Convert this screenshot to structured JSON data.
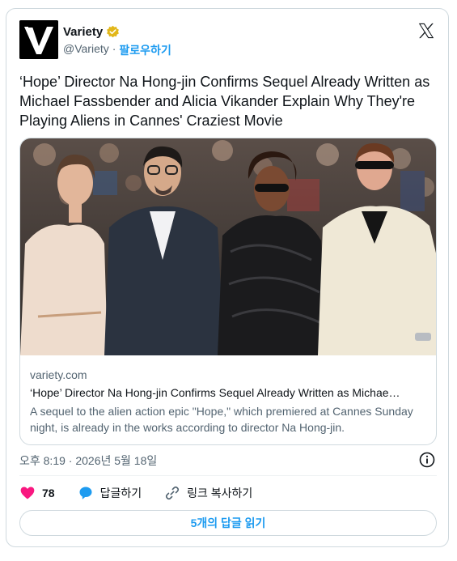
{
  "account": {
    "name": "Variety",
    "handle": "@Variety",
    "separator": "·",
    "follow_label": "팔로우하기"
  },
  "tweet": {
    "text": "‘Hope’ Director Na Hong-jin Confirms Sequel Already Written as Michael Fassbender and Alicia Vikander Explain Why They're Playing Aliens in Cannes' Craziest Movie"
  },
  "link_card": {
    "domain": "variety.com",
    "title": "‘Hope’ Director Na Hong-jin Confirms Sequel Already Written as Michae…",
    "description": "A sequel to the alien action epic \"Hope,\" which premiered at Cannes Sunday night, is already in the works according to director Na Hong-jin."
  },
  "timestamp": "오후 8:19 · 2026년 5월 18일",
  "actions": {
    "like_count": "78",
    "reply_label": "답글하기",
    "copy_link_label": "링크 복사하기"
  },
  "read_replies_label": "5개의 답글 읽기",
  "colors": {
    "like": "#f91880",
    "reply": "#1d9bf0",
    "accent": "#1d9bf0",
    "verified": "#e2b719"
  },
  "icons": [
    "variety-logo-icon",
    "verified-badge-icon",
    "x-logo-icon",
    "info-icon",
    "heart-icon",
    "reply-bubble-icon",
    "link-icon"
  ]
}
